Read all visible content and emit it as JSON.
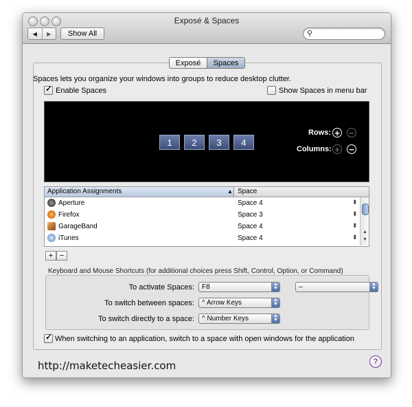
{
  "window": {
    "title": "Exposé & Spaces"
  },
  "toolbar": {
    "back": "◀",
    "forward": "▶",
    "show_all": "Show All",
    "search_placeholder": ""
  },
  "tabs": [
    {
      "label": "Exposé"
    },
    {
      "label": "Spaces"
    }
  ],
  "description": "Spaces lets you organize your windows into groups to reduce desktop clutter.",
  "enable_spaces": {
    "label": "Enable Spaces",
    "checked": true
  },
  "show_in_menubar": {
    "label": "Show Spaces in menu bar",
    "checked": false
  },
  "spaces_grid": {
    "spaces": [
      "1",
      "2",
      "3",
      "4"
    ],
    "rows_label": "Rows:",
    "columns_label": "Columns:",
    "plus": "+",
    "minus": "−"
  },
  "assignments": {
    "headers": {
      "app": "Application Assignments",
      "space": "Space"
    },
    "sort_indicator": "▲",
    "rows": [
      {
        "app": "Aperture",
        "space": "Space 4",
        "icon": "aperture-icon",
        "color": "#333333"
      },
      {
        "app": "Firefox",
        "space": "Space 3",
        "icon": "firefox-icon",
        "color": "#e07a1f"
      },
      {
        "app": "GarageBand",
        "space": "Space 4",
        "icon": "guitar-icon",
        "color": "#b5651d"
      },
      {
        "app": "iTunes",
        "space": "Space 4",
        "icon": "itunes-icon",
        "color": "#4a7fc1"
      }
    ],
    "add": "+",
    "remove": "−"
  },
  "shortcuts": {
    "title": "Keyboard and Mouse Shortcuts (for additional choices press Shift, Control, Option, or Command)",
    "activate_label": "To activate Spaces:",
    "activate_value": "F8",
    "activate_mouse_value": "–",
    "switch_between_label": "To switch between spaces:",
    "switch_between_value": "^ Arrow Keys",
    "switch_direct_label": "To switch directly to a space:",
    "switch_direct_value": "^ Number Keys"
  },
  "switch_option": {
    "label": "When switching to an application, switch to a space with open windows for the application",
    "checked": true
  },
  "watermark": "http://maketecheasier.com",
  "help": "?"
}
